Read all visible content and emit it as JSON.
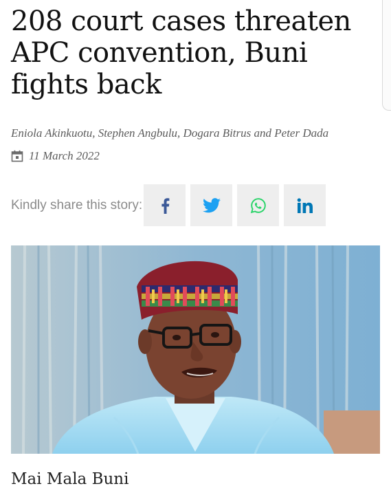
{
  "article": {
    "headline": "208 court cases threaten APC convention, Buni fights back",
    "authors": "Eniola Akinkuotu, Stephen Angbulu, Dogara Bitrus and Peter Dada",
    "date": "11 March 2022",
    "date_icon": "calendar-icon"
  },
  "share": {
    "label": "Kindly share this story:",
    "buttons": [
      {
        "name": "facebook",
        "icon": "facebook-icon",
        "color": "#3b5998"
      },
      {
        "name": "twitter",
        "icon": "twitter-icon",
        "color": "#1da1f2"
      },
      {
        "name": "whatsapp",
        "icon": "whatsapp-icon",
        "color": "#25d366"
      },
      {
        "name": "linkedin",
        "icon": "linkedin-icon",
        "color": "#0077b5"
      }
    ]
  },
  "photo": {
    "caption": "Mai Mala Buni"
  },
  "colors": {
    "text": "#111111",
    "meta": "#5b5b5b",
    "share_bg": "#eeeeee"
  }
}
